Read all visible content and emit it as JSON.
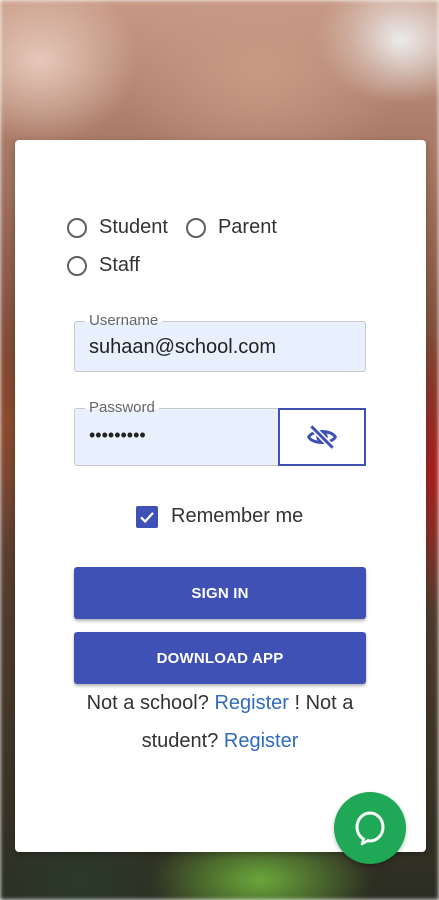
{
  "role_selector": {
    "options": [
      "Student",
      "Parent",
      "Staff"
    ],
    "selected": null
  },
  "username": {
    "label": "Username",
    "value": "suhaan@school.com"
  },
  "password": {
    "label": "Password",
    "value": "•••••••••"
  },
  "toggle_password_icon": "eye-slash-icon",
  "remember_me": {
    "label": "Remember me",
    "checked": true
  },
  "buttons": {
    "sign_in": "SIGN IN",
    "download_app": "DOWNLOAD APP"
  },
  "register": {
    "text_1": "Not a school?",
    "link_1": "Register",
    "text_2": "! Not a student?",
    "link_2": "Register"
  },
  "chat_icon": "chat-bubble-icon",
  "colors": {
    "primary": "#3f51b5",
    "link": "#2e6bbf",
    "chat": "#1fa855",
    "field_bg": "#e8f0fe"
  }
}
